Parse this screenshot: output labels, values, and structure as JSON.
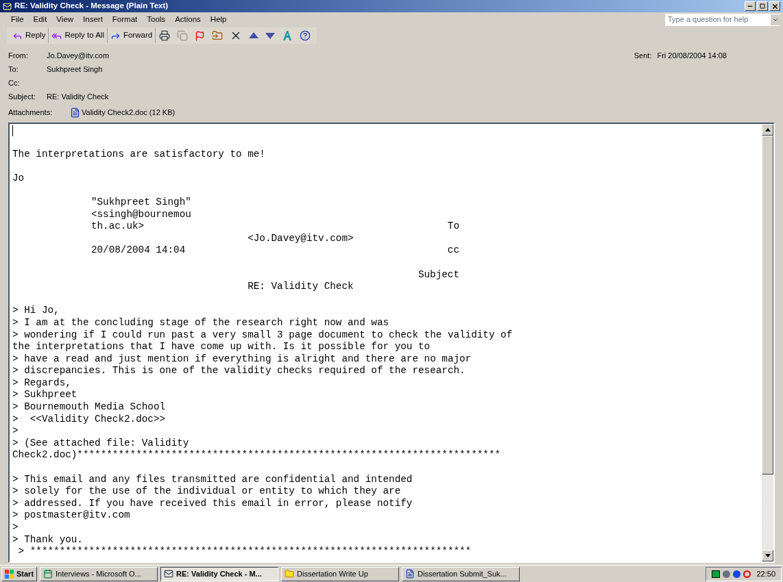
{
  "window": {
    "title": "RE: Validity Check - Message (Plain Text)"
  },
  "menu": [
    "File",
    "Edit",
    "View",
    "Insert",
    "Format",
    "Tools",
    "Actions",
    "Help"
  ],
  "help_box": {
    "placeholder": "Type a question for help"
  },
  "toolbar": {
    "buttons": [
      {
        "kind": "reply",
        "label": "Reply"
      },
      {
        "kind": "reply_all",
        "label": "Reply to All"
      },
      {
        "kind": "forward",
        "label": "Forward"
      }
    ],
    "icon_buttons": [
      {
        "kind": "print",
        "disabled": false
      },
      {
        "kind": "copy",
        "disabled": true
      },
      {
        "kind": "flag",
        "disabled": false
      },
      {
        "kind": "move",
        "disabled": false
      },
      {
        "kind": "delete",
        "disabled": false
      },
      {
        "kind": "previous",
        "disabled": false
      },
      {
        "kind": "next",
        "disabled": false
      },
      {
        "kind": "address_book",
        "disabled": false
      },
      {
        "kind": "help",
        "disabled": false
      }
    ]
  },
  "header": {
    "fields": [
      {
        "label": "From:",
        "value": "Jo.Davey@itv.com"
      },
      {
        "label": "To:",
        "value": "Sukhpreet Singh"
      },
      {
        "label": "Cc:"
      },
      {
        "label": "Subject:",
        "value": "RE: Validity Check"
      }
    ],
    "sent_label": "Sent:",
    "sent_value": "Fri 20/08/2004 14:08",
    "attachments_label": "Attachments:",
    "attachment": "Validity Check2.doc (12 KB)"
  },
  "body": {
    "reply_paragraphs": [
      "The interpretations are satisfactory to me!",
      "Jo"
    ],
    "quoted_header": {
      "sender_lines": [
        "\"Sukhpreet Singh\"",
        "<ssingh@bournemou",
        "th.ac.uk>"
      ],
      "date": "20/08/2004 14:04",
      "to_label": "To",
      "to_value": "<Jo.Davey@itv.com>",
      "cc_label": "cc",
      "subject_label": "Subject",
      "subject_value": "RE: Validity Check"
    },
    "quoted_groups": [
      [
        "> Hi Jo,",
        "> I am at the concluding stage of the research right now and was",
        "> wondering if I could run past a very small 3 page document to check the validity of",
        "the interpretations that I have come up with. Is it possible for you to",
        "> have a read and just mention if everything is alright and there are no major",
        "> discrepancies. This is one of the validity checks required of the research.",
        "> Regards,",
        "> Sukhpreet",
        "> Bournemouth Media School",
        ">  <<Validity Check2.doc>>",
        ">",
        "> (See attached file: Validity",
        "Check2.doc)************************************************************************"
      ],
      [
        "> This email and any files transmitted are confidential and intended",
        "> solely for the use of the individual or entity to which they are",
        "> addressed. If you have received this email in error, please notify",
        "> postmaster@itv.com",
        ">",
        "> Thank you.",
        " > ***************************************************************************"
      ]
    ]
  },
  "taskbar": {
    "start": "Start",
    "tasks": [
      {
        "kind": "calendar",
        "label": "Interviews - Microsoft O...",
        "selected": false
      },
      {
        "kind": "mail",
        "label": "RE: Validity Check - M...",
        "selected": true
      },
      {
        "kind": "folder",
        "label": "Dissertation Write Up",
        "selected": false
      },
      {
        "kind": "document",
        "label": "Dissertation Submit_Suk...",
        "selected": false
      }
    ],
    "clock": "22:50"
  }
}
